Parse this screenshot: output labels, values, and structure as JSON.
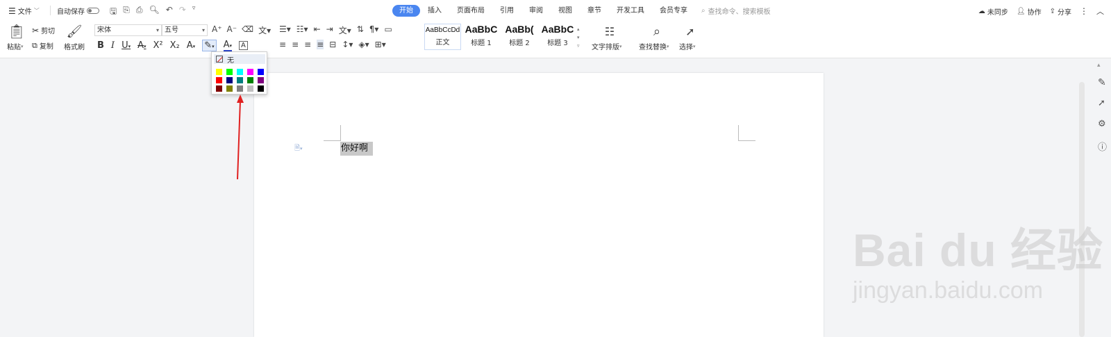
{
  "topbar": {
    "menu_label": "文件",
    "autosave_label": "自动保存",
    "tabs": [
      "开始",
      "插入",
      "页面布局",
      "引用",
      "审阅",
      "视图",
      "章节",
      "开发工具",
      "会员专享"
    ],
    "search_placeholder": "查找命令、搜索模板",
    "sync_label": "未同步",
    "collab_label": "协作",
    "share_label": "分享"
  },
  "ribbon": {
    "paste_label": "粘贴",
    "cut_label": "剪切",
    "copy_label": "复制",
    "format_painter_label": "格式刷",
    "font_name": "宋体",
    "font_size": "五号",
    "styles": [
      {
        "sample": "AaBbCcDd",
        "name": "正文"
      },
      {
        "sample": "AaBbC",
        "name": "标题 1"
      },
      {
        "sample": "AaBb(",
        "name": "标题 2"
      },
      {
        "sample": "AaBbC",
        "name": "标题 3"
      }
    ],
    "text_layout_label": "文字排版",
    "find_replace_label": "查找替换",
    "select_label": "选择"
  },
  "highlight_popup": {
    "none_label": "无",
    "colors": [
      [
        "#ffff00",
        "#00ff00",
        "#00ffff",
        "#ff00ff",
        "#0000ff"
      ],
      [
        "#ff0000",
        "#000080",
        "#008080",
        "#008000",
        "#800080"
      ],
      [
        "#800000",
        "#808000",
        "#808080",
        "#c0c0c0",
        "#000000"
      ]
    ]
  },
  "document": {
    "text": "你好啊"
  },
  "watermark": {
    "main": "Bai du 经验",
    "sub": "jingyan.baidu.com"
  },
  "colors": {
    "accent": "#4a86f0",
    "arrow": "#e02020",
    "selection": "#c8c8c8"
  }
}
